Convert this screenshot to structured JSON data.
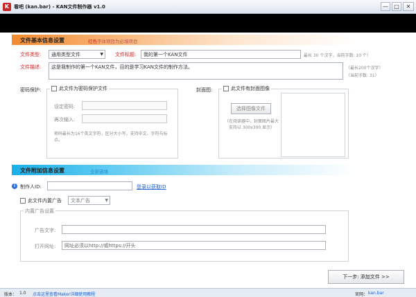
{
  "window": {
    "title": "看吧 (kan.bar) - KAN文件制作器 v1.0",
    "min": "—",
    "max": "□",
    "close": "✕"
  },
  "section1": {
    "title": "文件基本信息设置",
    "hint_red": "红色",
    "hint_rest": "字体项目为必填项目"
  },
  "file_type": {
    "label": "文件类型:",
    "value": "通用类型文件"
  },
  "file_title": {
    "label": "文件标题:",
    "value": "我的第一个KAN文件",
    "hint": "最长 30 个汉字，当前字数: 10 个）"
  },
  "file_desc": {
    "label": "文件描述:",
    "value": "这是我制作的第一个KAN文件，目的是学习KAN文件的制作方法。",
    "hint1": "（最长200个汉字）",
    "hint2": "（当前字数: 31）"
  },
  "password": {
    "section_label": "密码保护:",
    "checkbox_label": "此文件为密码保护文件",
    "pwd_label": "设定密码:",
    "pwd2_label": "再次输入:",
    "note": "密码最长为16个英文字符，区分大小写，支持中文、字符与标点。"
  },
  "cover": {
    "section_label": "封面图:",
    "checkbox_label": "此文件有封面图像",
    "select_button": "选择图像文件",
    "note": "（在阅读器中，封面图片最大支持以 300x300 显示）"
  },
  "section2": {
    "title": "文件附加信息设置",
    "hint": "全部选填"
  },
  "author": {
    "label": "制作人ID:",
    "value": "",
    "login_link": "登录以获取ID"
  },
  "ad": {
    "checkbox_label": "此文件内置广告",
    "type_value": "文本广告",
    "group_title": "内置广告设置",
    "text_label": "广告文字:",
    "text_value": "",
    "url_label": "打开网址:",
    "url_value": "网址必须以http://或https://开头"
  },
  "next_button": "下一步: 添加文件 >>",
  "footer": {
    "version_label": "版本：",
    "version": "1.0",
    "help_link": "点击这里查看Maker详细使用教程",
    "site_label": "官网：",
    "site_link": "kan.bar"
  }
}
